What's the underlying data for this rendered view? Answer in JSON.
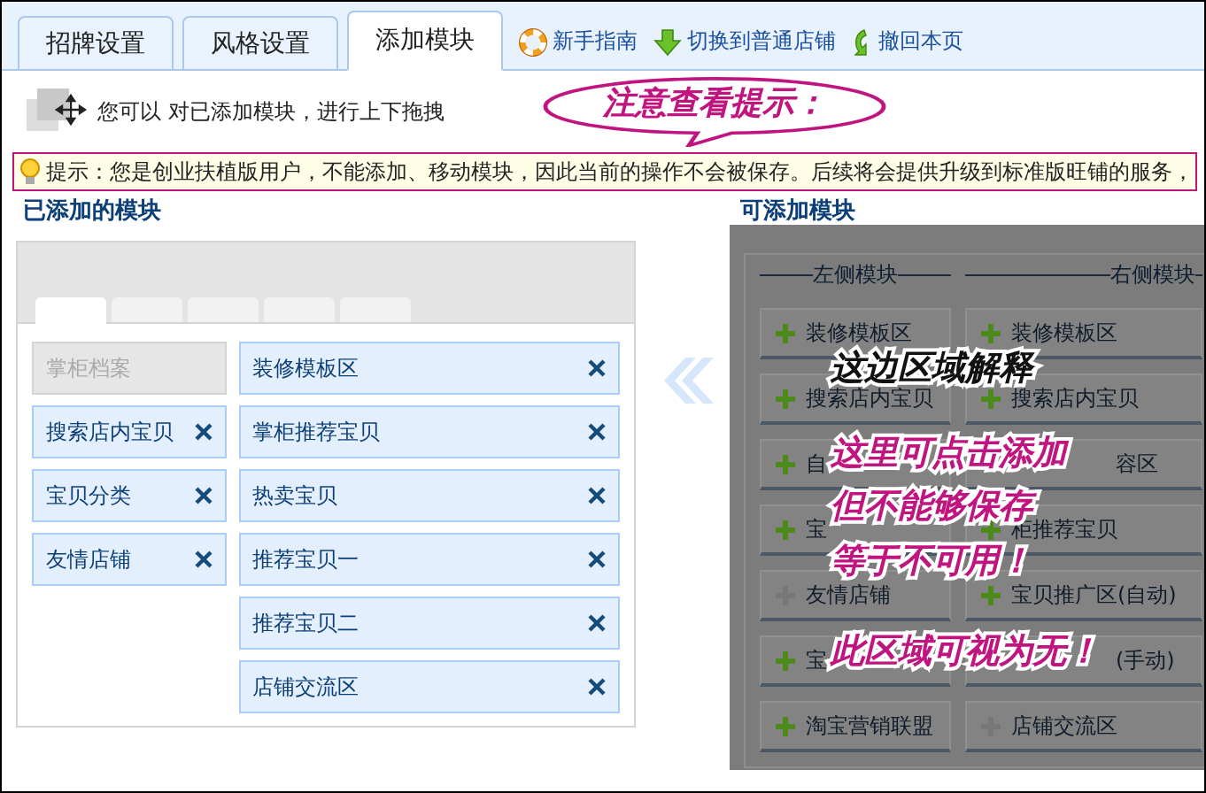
{
  "tabs": [
    {
      "label": "招牌设置",
      "selected": false
    },
    {
      "label": "风格设置",
      "selected": false
    },
    {
      "label": "添加模块",
      "selected": true
    }
  ],
  "links": [
    "新手指南",
    "切换到普通店铺",
    "撤回本页"
  ],
  "drag_hint": "您可以 对已添加模块，进行上下拖拽",
  "callout": "注意查看提示：",
  "tip": "提示：您是创业扶植版用户，不能添加、移动模块，因此当前的操作不会被保存。后续将会提供升级到标准版旺铺的服务，",
  "added": {
    "title": "已添加的模块",
    "layout_tabs": [
      {
        "selected": true
      },
      {
        "selected": false
      },
      {
        "selected": false
      },
      {
        "selected": false
      },
      {
        "selected": false
      }
    ],
    "left_modules": [
      {
        "label": "掌柜档案",
        "removable": false
      },
      {
        "label": "搜索店内宝贝",
        "removable": true
      },
      {
        "label": "宝贝分类",
        "removable": true
      },
      {
        "label": "友情店铺",
        "removable": true
      }
    ],
    "right_modules": [
      {
        "label": "装修模板区",
        "removable": true
      },
      {
        "label": "掌柜推荐宝贝",
        "removable": true
      },
      {
        "label": "热卖宝贝",
        "removable": true
      },
      {
        "label": "推荐宝贝一",
        "removable": true
      },
      {
        "label": "推荐宝贝二",
        "removable": true
      },
      {
        "label": "店铺交流区",
        "removable": true
      }
    ]
  },
  "available": {
    "title": "可添加模块",
    "left_heading": "左侧模块",
    "right_heading": "右侧模块",
    "left": [
      {
        "label": "装修模板区",
        "kind": "full",
        "disabled": false
      },
      {
        "label": "搜索店内宝贝",
        "kind": "full",
        "disabled": false
      },
      {
        "label": "自",
        "kind": "full",
        "disabled": false
      },
      {
        "label": "宝",
        "kind": "full",
        "disabled": false
      },
      {
        "label": "友情店铺",
        "kind": "full",
        "disabled": true
      },
      {
        "label": "宝",
        "kind": "full",
        "disabled": false
      },
      {
        "label": "淘宝营销联盟",
        "kind": "full",
        "disabled": false
      }
    ],
    "right": [
      {
        "label": "装修模板区",
        "kind": "full",
        "disabled": false
      },
      {
        "label": "搜索店内宝贝",
        "kind": "full",
        "disabled": false
      },
      {
        "label": "容区",
        "kind": "tail"
      },
      {
        "label": "柜推荐宝贝",
        "kind": "full",
        "disabled": false
      },
      {
        "label": "宝贝推广区(自动)",
        "kind": "full",
        "disabled": false
      },
      {
        "label": "(手动)",
        "kind": "tail"
      },
      {
        "label": "店铺交流区",
        "kind": "full",
        "disabled": true
      }
    ]
  },
  "annotations": [
    {
      "text": "这边区域解释",
      "kind": "heading"
    },
    {
      "text": "这里可点击添加",
      "kind": "note"
    },
    {
      "text": "但不能够保存",
      "kind": "note"
    },
    {
      "text": "等于不可用！",
      "kind": "note"
    },
    {
      "text": "此区域可视为无！",
      "kind": "note"
    }
  ]
}
